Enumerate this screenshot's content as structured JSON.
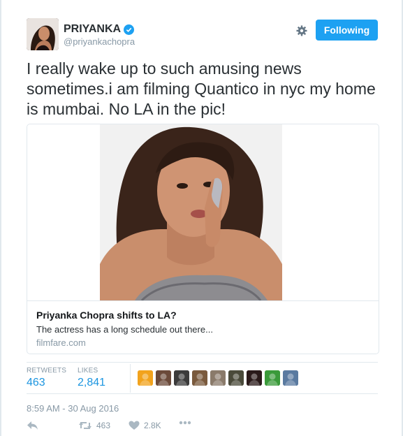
{
  "user": {
    "name": "PRIYANKA",
    "handle": "@priyankachopra",
    "verified": true
  },
  "header": {
    "follow_label": "Following",
    "settings_icon": "gear-icon"
  },
  "tweet": {
    "text": "I really wake up to such amusing news sometimes.i am filming Quantico in nyc my home is mumbai. No LA in the pic!",
    "timestamp": "8:59 AM - 30 Aug 2016"
  },
  "card": {
    "title": "Priyanka Chopra shifts to LA?",
    "description": "The actress has a long schedule out there...",
    "domain": "filmfare.com"
  },
  "stats": {
    "retweets_label": "RETWEETS",
    "retweets_value": "463",
    "likes_label": "LIKES",
    "likes_value": "2,841"
  },
  "likers": [
    {
      "name": "liker-1",
      "color": "#f2a31d"
    },
    {
      "name": "liker-2",
      "color": "#6b4a3a"
    },
    {
      "name": "liker-3",
      "color": "#3b3b3b"
    },
    {
      "name": "liker-4",
      "color": "#7a5a3d"
    },
    {
      "name": "liker-5",
      "color": "#8a7a6a"
    },
    {
      "name": "liker-6",
      "color": "#4a4a3a"
    },
    {
      "name": "liker-7",
      "color": "#2a1a1a"
    },
    {
      "name": "liker-8",
      "color": "#3a9a3a"
    },
    {
      "name": "liker-9",
      "color": "#5a7aa0"
    }
  ],
  "actions": {
    "reply_icon": "reply-icon",
    "retweet_icon": "retweet-icon",
    "retweet_count": "463",
    "like_icon": "heart-icon",
    "like_count": "2.8K",
    "more_icon": "more-icon"
  },
  "colors": {
    "accent": "#1da1f2",
    "link": "#1b95e0",
    "muted": "#8899a6"
  }
}
